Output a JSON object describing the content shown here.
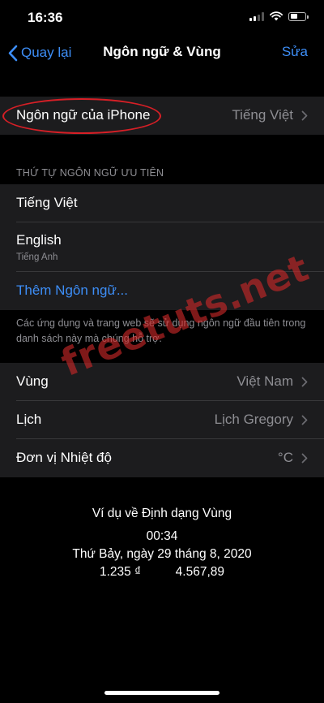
{
  "status_bar": {
    "time": "16:36",
    "signal_icon": "cellular-signal-icon",
    "wifi_icon": "wifi-icon",
    "battery_icon": "battery-icon"
  },
  "nav": {
    "back_label": "Quay lại",
    "title": "Ngôn ngữ & Vùng",
    "edit_label": "Sửa"
  },
  "iphone_language": {
    "label": "Ngôn ngữ của iPhone",
    "value": "Tiếng Việt"
  },
  "preferred_section": {
    "header": "THỨ TỰ NGÔN NGỮ ƯU TIÊN",
    "languages": [
      {
        "name": "Tiếng Việt",
        "subtitle": ""
      },
      {
        "name": "English",
        "subtitle": "Tiếng Anh"
      }
    ],
    "add_label": "Thêm Ngôn ngữ...",
    "footer": "Các ứng dụng và trang web sẽ sử dụng ngôn ngữ đầu tiên trong danh sách này mà chúng hỗ trợ."
  },
  "region_settings": [
    {
      "label": "Vùng",
      "value": "Việt Nam"
    },
    {
      "label": "Lịch",
      "value": "Lịch Gregory"
    },
    {
      "label": "Đơn vị Nhiệt độ",
      "value": "°C"
    }
  ],
  "format_example": {
    "title": "Ví dụ về Định dạng Vùng",
    "time": "00:34",
    "date": "Thứ Bảy, ngày 29 tháng 8, 2020",
    "currency": "1.235 ₫",
    "number": "4.567,89"
  },
  "watermark": {
    "text": "freetuts.net"
  },
  "colors": {
    "background": "#000000",
    "cell_background": "#1c1c1e",
    "accent_blue": "#3d8ef7",
    "secondary_text": "#8e8e93",
    "highlight_oval": "#d71f26",
    "watermark": "#cd2828"
  }
}
